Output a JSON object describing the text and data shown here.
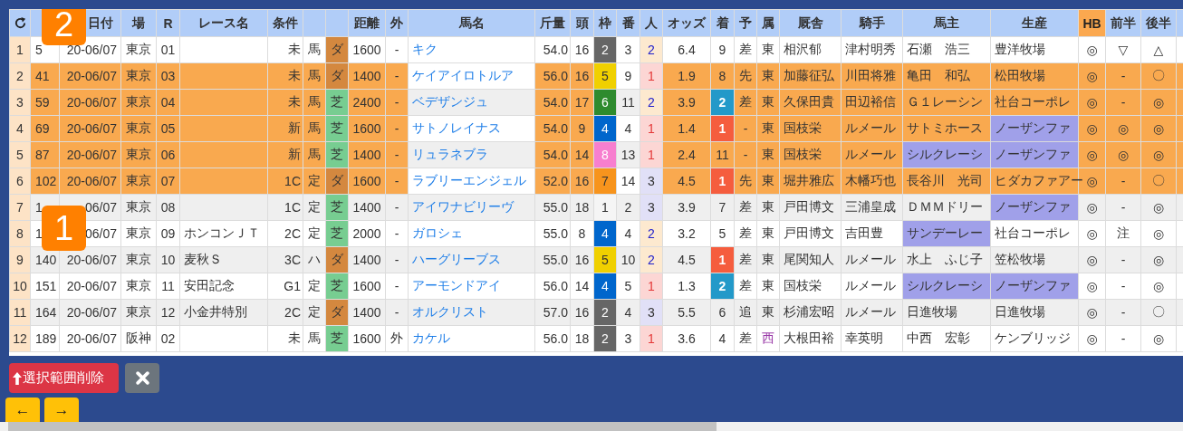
{
  "table": {
    "columns": [
      {
        "kind": "rownum"
      },
      {
        "kind": "blank"
      },
      {
        "kind": "text",
        "label": "日付"
      },
      {
        "kind": "text",
        "label": "場"
      },
      {
        "kind": "text",
        "label": "R"
      },
      {
        "kind": "text",
        "label": "レース名"
      },
      {
        "kind": "text",
        "label": "条件"
      },
      {
        "kind": "blank"
      },
      {
        "kind": "blank"
      },
      {
        "kind": "text",
        "label": "距離"
      },
      {
        "kind": "text",
        "label": "外"
      },
      {
        "kind": "link",
        "label": "馬名"
      },
      {
        "kind": "text",
        "label": "斤量"
      },
      {
        "kind": "text",
        "label": "頭"
      },
      {
        "kind": "text",
        "label": "枠"
      },
      {
        "kind": "plain",
        "label": "番"
      },
      {
        "kind": "pop",
        "label": "人"
      },
      {
        "kind": "text",
        "label": "オッズ"
      },
      {
        "kind": "text",
        "label": "着"
      },
      {
        "kind": "text",
        "label": "予"
      },
      {
        "kind": "text",
        "label": "属"
      },
      {
        "kind": "text",
        "label": "厩舎"
      },
      {
        "kind": "text",
        "label": "騎手"
      },
      {
        "kind": "text",
        "label": "馬主"
      },
      {
        "kind": "text",
        "label": "生産"
      },
      {
        "kind": "accent",
        "label": "HB"
      },
      {
        "kind": "text",
        "label": "前半"
      },
      {
        "kind": "text",
        "label": "後半"
      },
      {
        "kind": "blank"
      }
    ],
    "rows": [
      {
        "highlighted": false,
        "cells": [
          "1",
          "5",
          "20-06/07",
          "東京",
          "01",
          null,
          "未",
          "馬",
          {
            "text": "ダ",
            "kind": "dirt"
          },
          "1600",
          "-",
          "キク",
          "54.0",
          "16",
          {
            "text": "2",
            "color": "#666666"
          },
          "3",
          {
            "text": "2",
            "kind": "pop2"
          },
          "6.4",
          "9",
          "差",
          "東",
          "相沢郁",
          "津村明秀",
          "石瀬　浩三",
          "豊洋牧場",
          "◎",
          "▽",
          "△"
        ]
      },
      {
        "highlighted": true,
        "cells": [
          "2",
          "41",
          "20-06/07",
          "東京",
          "03",
          null,
          "未",
          "馬",
          {
            "text": "ダ",
            "kind": "dirt"
          },
          "1400",
          "-",
          "ケイアイロトルア",
          "56.0",
          "16",
          {
            "text": "5",
            "color": "#f0d000"
          },
          "9",
          {
            "text": "1",
            "kind": "pop1"
          },
          "1.9",
          "8",
          "先",
          "東",
          "加藤征弘",
          "川田将雅",
          "亀田　和弘",
          "松田牧場",
          "◎",
          "-",
          "〇"
        ]
      },
      {
        "highlighted": true,
        "cells": [
          "3",
          "59",
          "20-06/07",
          "東京",
          "04",
          null,
          "未",
          "馬",
          {
            "text": "芝",
            "kind": "turf"
          },
          "2400",
          "-",
          "ベデザンジュ",
          "54.0",
          "17",
          {
            "text": "6",
            "color": "#2e8b2e"
          },
          "11",
          {
            "text": "2",
            "kind": "pop2"
          },
          "3.9",
          {
            "text": "2",
            "kind": "second"
          },
          "差",
          "東",
          "久保田貴",
          "田辺裕信",
          "Ｇ１レーシン",
          "社台コーポレ",
          "◎",
          "-",
          "◎"
        ]
      },
      {
        "highlighted": true,
        "cells": [
          "4",
          "69",
          "20-06/07",
          "東京",
          "05",
          null,
          "新",
          "馬",
          {
            "text": "芝",
            "kind": "turf"
          },
          "1600",
          "-",
          "サトノレイナス",
          "54.0",
          "9",
          {
            "text": "4",
            "color": "#0066cc"
          },
          "4",
          {
            "text": "1",
            "kind": "pop1"
          },
          "1.4",
          {
            "text": "1",
            "kind": "first"
          },
          "-",
          "東",
          "国枝栄",
          "ルメール",
          "サトミホース",
          {
            "text": "ノーザンファ",
            "marked": true
          },
          "◎",
          "◎",
          "◎"
        ]
      },
      {
        "highlighted": true,
        "cells": [
          "5",
          "87",
          "20-06/07",
          "東京",
          "06",
          null,
          "新",
          "馬",
          {
            "text": "芝",
            "kind": "turf"
          },
          "1400",
          "-",
          "リュラネブラ",
          "54.0",
          "14",
          {
            "text": "8",
            "color": "#f77fcf"
          },
          "13",
          {
            "text": "1",
            "kind": "pop1"
          },
          "2.4",
          "11",
          "-",
          "東",
          "国枝栄",
          "ルメール",
          {
            "text": "シルクレーシ",
            "marked": true
          },
          {
            "text": "ノーザンファ",
            "marked": true
          },
          "◎",
          "◎",
          "◎"
        ]
      },
      {
        "highlighted": true,
        "cells": [
          "6",
          "102",
          "20-06/07",
          "東京",
          "07",
          null,
          "1C",
          "定",
          {
            "text": "ダ",
            "kind": "dirt"
          },
          "1600",
          "-",
          "ラブリーエンジェル",
          "52.0",
          "16",
          {
            "text": "7",
            "color": "#f7941d"
          },
          "14",
          {
            "text": "3",
            "kind": "pop3"
          },
          "4.5",
          {
            "text": "1",
            "kind": "first"
          },
          "先",
          "東",
          "堀井雅広",
          "木幡巧也",
          "長谷川　光司",
          "ヒダカファアー",
          "◎",
          "-",
          "〇"
        ]
      },
      {
        "highlighted": false,
        "cells": [
          "7",
          "1",
          "06/07",
          "東京",
          "08",
          null,
          "1C",
          "定",
          {
            "text": "芝",
            "kind": "turf"
          },
          "1400",
          "-",
          "アイワナビリーヴ",
          "55.0",
          "18",
          {
            "text": "1",
            "color": "#f5f5f5"
          },
          "2",
          {
            "text": "3",
            "kind": "pop3"
          },
          "3.9",
          "7",
          "差",
          "東",
          "戸田博文",
          "三浦皇成",
          "ＤＭＭドリー",
          {
            "text": "ノーザンファ",
            "marked": true
          },
          "◎",
          "-",
          "◎"
        ]
      },
      {
        "highlighted": false,
        "cells": [
          "8",
          "1",
          "06/07",
          "東京",
          "09",
          "ホンコンＪＴ",
          "2C",
          "定",
          {
            "text": "芝",
            "kind": "turf"
          },
          "2000",
          "-",
          "ガロシェ",
          "55.0",
          "8",
          {
            "text": "4",
            "color": "#0066cc"
          },
          "4",
          {
            "text": "2",
            "kind": "pop2"
          },
          "3.2",
          "5",
          "差",
          "東",
          "戸田博文",
          "吉田豊",
          {
            "text": "サンデーレー",
            "marked": true
          },
          "社台コーポレ",
          "◎",
          "注",
          "◎"
        ]
      },
      {
        "highlighted": false,
        "cells": [
          "9",
          "140",
          "20-06/07",
          "東京",
          "10",
          "麦秋Ｓ",
          "3C",
          "ハ",
          {
            "text": "ダ",
            "kind": "dirt"
          },
          "1400",
          "-",
          "ハーグリーブス",
          "55.0",
          "16",
          {
            "text": "5",
            "color": "#f0d000"
          },
          "10",
          {
            "text": "2",
            "kind": "pop2"
          },
          "4.5",
          {
            "text": "1",
            "kind": "first"
          },
          "差",
          "東",
          "尾関知人",
          "ルメール",
          "水上　ふじ子",
          "笠松牧場",
          "◎",
          "-",
          "◎"
        ]
      },
      {
        "highlighted": false,
        "cells": [
          "10",
          "151",
          "20-06/07",
          "東京",
          "11",
          "安田記念",
          "G1",
          "定",
          {
            "text": "芝",
            "kind": "turf"
          },
          "1600",
          "-",
          "アーモンドアイ",
          "56.0",
          "14",
          {
            "text": "4",
            "color": "#0066cc"
          },
          "5",
          {
            "text": "1",
            "kind": "pop1"
          },
          "1.3",
          {
            "text": "2",
            "kind": "second"
          },
          "差",
          "東",
          "国枝栄",
          "ルメール",
          {
            "text": "シルクレーシ",
            "marked": true
          },
          {
            "text": "ノーザンファ",
            "marked": true
          },
          "◎",
          "-",
          "◎"
        ]
      },
      {
        "highlighted": false,
        "cells": [
          "11",
          "164",
          "20-06/07",
          "東京",
          "12",
          "小金井特別",
          "2C",
          "定",
          {
            "text": "ダ",
            "kind": "dirt"
          },
          "1400",
          "-",
          "オルクリスト",
          "57.0",
          "16",
          {
            "text": "2",
            "color": "#666666"
          },
          "4",
          {
            "text": "3",
            "kind": "pop3"
          },
          "5.5",
          "6",
          "追",
          "東",
          "杉浦宏昭",
          "ルメール",
          "日進牧場",
          "日進牧場",
          "◎",
          "-",
          "〇"
        ]
      },
      {
        "highlighted": false,
        "cells": [
          "12",
          "189",
          "20-06/07",
          "阪神",
          "02",
          null,
          "未",
          "馬",
          {
            "text": "芝",
            "kind": "turf"
          },
          "1600",
          "外",
          "カケル",
          "56.0",
          "18",
          {
            "text": "2",
            "color": "#666666"
          },
          "3",
          {
            "text": "1",
            "kind": "pop1"
          },
          "3.6",
          "4",
          "差",
          {
            "text": "西",
            "color": "#9a3aa8"
          },
          "大根田裕",
          "幸英明",
          "中西　宏彰",
          "ケンブリッジ",
          "◎",
          "-",
          "◎"
        ]
      }
    ]
  },
  "markers": [
    {
      "label": "2"
    },
    {
      "label": "1"
    }
  ],
  "toolbar": {
    "delete_button": {
      "label": "選択範囲削除"
    },
    "nav_buttons": [
      {
        "label": "←"
      },
      {
        "label": "→"
      }
    ]
  }
}
